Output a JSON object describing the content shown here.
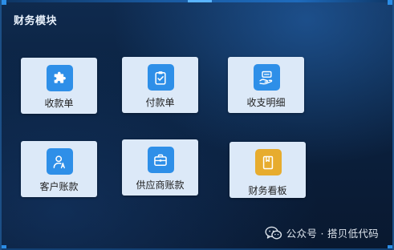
{
  "panel": {
    "title": "财务模块"
  },
  "cards": [
    {
      "label": "收款单",
      "icon": "puzzle-icon"
    },
    {
      "label": "付款单",
      "icon": "clipboard-check-icon"
    },
    {
      "label": "收支明细",
      "icon": "hand-money-icon"
    },
    {
      "label": "客户账款",
      "icon": "customer-icon"
    },
    {
      "label": "供应商账款",
      "icon": "briefcase-icon"
    },
    {
      "label": "财务看板",
      "icon": "board-icon"
    }
  ],
  "watermark": {
    "text": "公众号 · 搭贝低代码"
  },
  "colors": {
    "icon_blue": "#2e8fe8",
    "icon_gold": "#e7ac2e",
    "card_bg": "#dce9f8",
    "panel_bg": "#0b2342"
  }
}
